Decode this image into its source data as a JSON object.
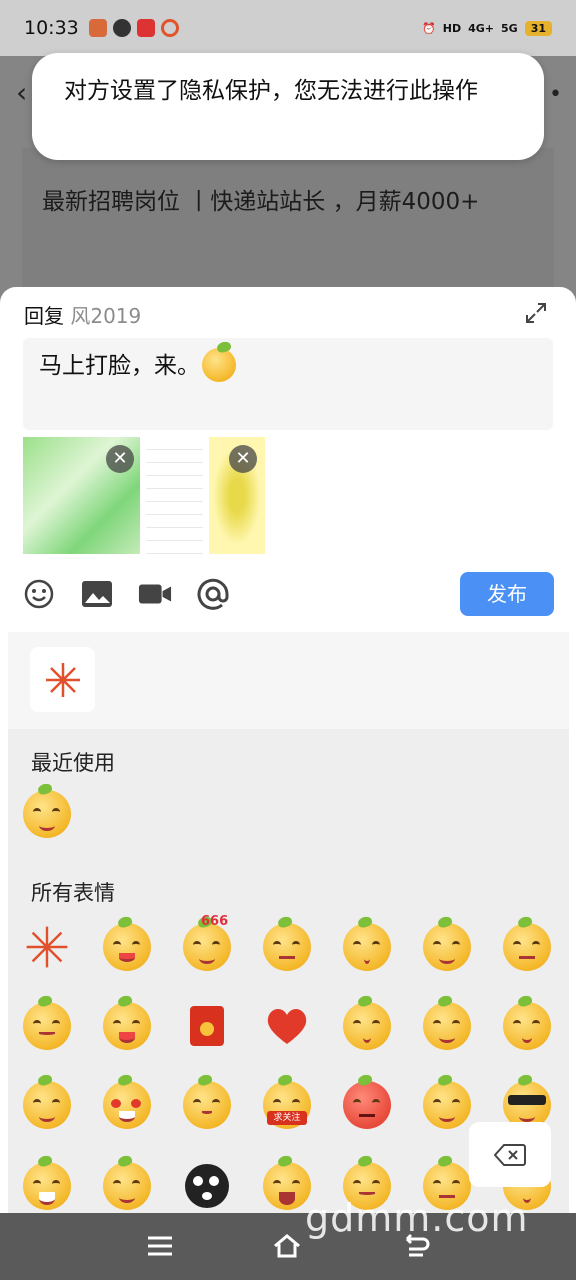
{
  "status_bar": {
    "time": "10:33",
    "network": "4G+",
    "network2": "5G",
    "hd": "HD",
    "battery": "31"
  },
  "background_post": {
    "text": "最新招聘岗位 丨快递站站长 ，月薪4000+"
  },
  "toast": {
    "message": "对方设置了隐私保护，您无法进行此操作"
  },
  "reply": {
    "prefix": "回复",
    "username": "风2019",
    "input_text": "马上打脸，来。",
    "publish_label": "发布",
    "toolbar_icons": [
      "emoji-icon",
      "image-icon",
      "video-icon",
      "at-icon"
    ]
  },
  "emoji_panel": {
    "recent_title": "最近使用",
    "all_title": "所有表情",
    "stickers": [
      "666",
      "求关注"
    ]
  },
  "watermark": "gdmm.com",
  "colors": {
    "accent": "#4a90f5",
    "emoji_yellow": "#f4b82a"
  }
}
